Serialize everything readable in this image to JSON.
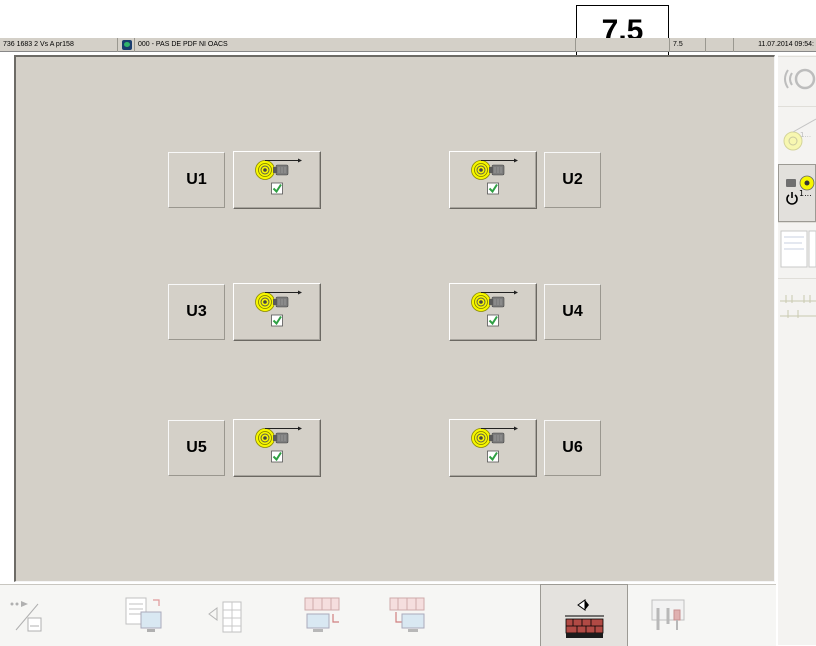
{
  "page_label": "7.5",
  "status_bar": {
    "machine": "736 1683 2 Vs A pr158",
    "message": "000 -  PAS DE PDF NI OACS",
    "version": "7.5",
    "datetime": "11.07.2014 09:54:"
  },
  "units": [
    {
      "label": "U1",
      "enabled": true
    },
    {
      "label": "U2",
      "enabled": true
    },
    {
      "label": "U3",
      "enabled": true
    },
    {
      "label": "U4",
      "enabled": true
    },
    {
      "label": "U5",
      "enabled": true
    },
    {
      "label": "U6",
      "enabled": true
    }
  ],
  "side_panel": {
    "items": [
      {
        "icon": "reel-sensor-icon"
      },
      {
        "icon": "reel-unwind-icon"
      },
      {
        "icon": "reel-power-icon"
      },
      {
        "icon": "documents-icon"
      },
      {
        "icon": "bars-icon"
      }
    ]
  },
  "toolbar": {
    "items": [
      {
        "icon": "transfer-icon"
      },
      {
        "icon": "reports-icon"
      },
      {
        "icon": "table-back-icon"
      },
      {
        "icon": "pallet-monitor-icon"
      },
      {
        "icon": "pallet-move-icon"
      },
      {
        "icon": "diamond-pallet-icon"
      },
      {
        "icon": "tools-icon"
      }
    ]
  },
  "colors": {
    "panel_bg": "#d4d0c8",
    "reel_yellow": "#f7f700",
    "check_green": "#2ea043",
    "brick_red": "#a52a2a"
  }
}
